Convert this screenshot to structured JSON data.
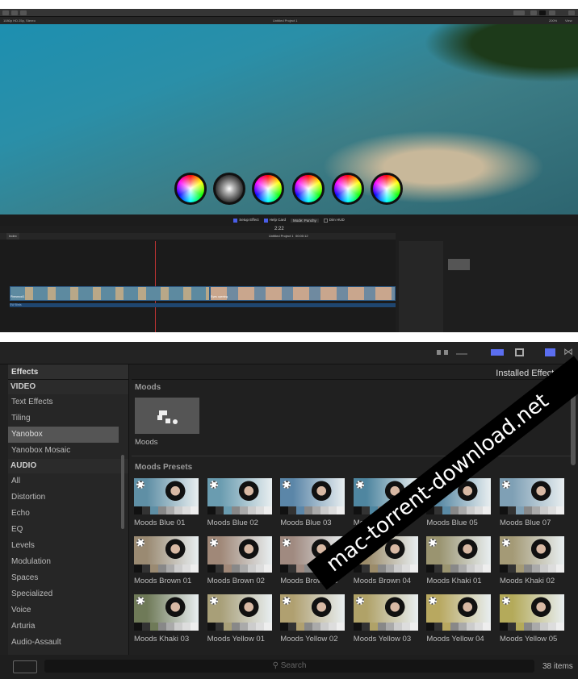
{
  "viewer": {
    "clip_info": "1080p HD 25p, Stereo",
    "project": "Untitled Project 1",
    "zoom": "200%",
    "view": "View"
  },
  "controls": {
    "setup_effect": "Setup Effect",
    "help_card": "Help Card",
    "mode": "Mode: Punchy",
    "dim_hud": "Dim HUD",
    "timecode": "2:22"
  },
  "timeline": {
    "index": "Index",
    "project": "Untitled Project 1",
    "duration": "00:00:12",
    "clip1": "Pinewood1",
    "clip2": "Eyes opening",
    "audio": "SW Birds"
  },
  "browser": {
    "title": "Effects",
    "filter": "Installed Effects",
    "sidebar": {
      "video_header": "VIDEO",
      "video_items": [
        "Text Effects",
        "Tiling",
        "Yanobox",
        "Yanobox Mosaic"
      ],
      "audio_header": "AUDIO",
      "audio_items": [
        "All",
        "Distortion",
        "Echo",
        "EQ",
        "Levels",
        "Modulation",
        "Spaces",
        "Specialized",
        "Voice",
        "Arturia",
        "Audio-Assault"
      ]
    },
    "moods_section": "Moods",
    "moods_item": "Moods",
    "presets_section": "Moods Presets",
    "presets": [
      {
        "name": "Moods Blue 01",
        "tint": "#5f8fa5"
      },
      {
        "name": "Moods Blue 02",
        "tint": "#6a9cb0"
      },
      {
        "name": "Moods Blue 03",
        "tint": "#5b86a8"
      },
      {
        "name": "Moods Blue 04",
        "tint": "#4f86a0"
      },
      {
        "name": "Moods Blue 05",
        "tint": "#5a8aa5"
      },
      {
        "name": "Moods Blue 07",
        "tint": "#7fa0b5"
      },
      {
        "name": "Moods Brown 01",
        "tint": "#9a8a72"
      },
      {
        "name": "Moods Brown 02",
        "tint": "#a08878"
      },
      {
        "name": "Moods Brown 03",
        "tint": "#a08a80"
      },
      {
        "name": "Moods Brown 04",
        "tint": "#9c8c6a"
      },
      {
        "name": "Moods Khaki 01",
        "tint": "#9a9470"
      },
      {
        "name": "Moods Khaki 02",
        "tint": "#a49a76"
      },
      {
        "name": "Moods Khaki 03",
        "tint": "#6f7a58"
      },
      {
        "name": "Moods Yellow 01",
        "tint": "#a89f78"
      },
      {
        "name": "Moods Yellow 02",
        "tint": "#b0a070"
      },
      {
        "name": "Moods Yellow 03",
        "tint": "#b0a268"
      },
      {
        "name": "Moods Yellow 04",
        "tint": "#b8a860"
      },
      {
        "name": "Moods Yellow 05",
        "tint": "#b4aa5a"
      }
    ],
    "search_placeholder": "Search",
    "count": "38 items"
  },
  "watermark": "mac-torrent-download.net",
  "accent": "#4a5ee8"
}
